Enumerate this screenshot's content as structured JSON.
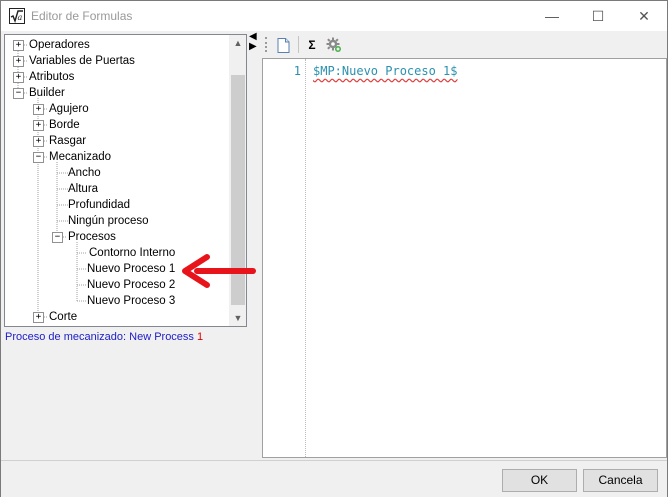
{
  "window": {
    "title": "Editor de Formulas",
    "controls": {
      "minimize": "—",
      "maximize": "☐",
      "close": "✕"
    }
  },
  "tree": {
    "nodes": [
      {
        "label": "Operadores",
        "expander": "+"
      },
      {
        "label": "Variables de Puertas",
        "expander": "+"
      },
      {
        "label": "Atributos",
        "expander": "+"
      },
      {
        "label": "Builder",
        "expander": "−"
      },
      {
        "label": "Agujero",
        "expander": "+"
      },
      {
        "label": "Borde",
        "expander": "+"
      },
      {
        "label": "Rasgar",
        "expander": "+"
      },
      {
        "label": "Mecanizado",
        "expander": "−"
      },
      {
        "label": "Ancho",
        "expander": ""
      },
      {
        "label": "Altura",
        "expander": ""
      },
      {
        "label": "Profundidad",
        "expander": ""
      },
      {
        "label": "Ningún proceso",
        "expander": ""
      },
      {
        "label": "Procesos",
        "expander": "−"
      },
      {
        "label": "Contorno Interno",
        "expander": ""
      },
      {
        "label": "Nuevo Proceso 1",
        "expander": ""
      },
      {
        "label": "Nuevo Proceso 2",
        "expander": ""
      },
      {
        "label": "Nuevo Proceso 3",
        "expander": ""
      },
      {
        "label": "Corte",
        "expander": "+"
      }
    ]
  },
  "status": {
    "text": "Proceso de mecanizado: New Process ",
    "number": "1"
  },
  "splitter": {
    "left_arrow": "◀",
    "right_arrow": "▶"
  },
  "toolbar": {
    "sigma": "Σ"
  },
  "editor": {
    "line_number": "1",
    "code": "$MP:Nuevo Proceso 1$"
  },
  "buttons": {
    "ok": "OK",
    "cancel": "Cancela"
  },
  "colors": {
    "code": "#2b91af",
    "status": "#1c1cc8",
    "annotation_arrow": "#e8141b"
  }
}
